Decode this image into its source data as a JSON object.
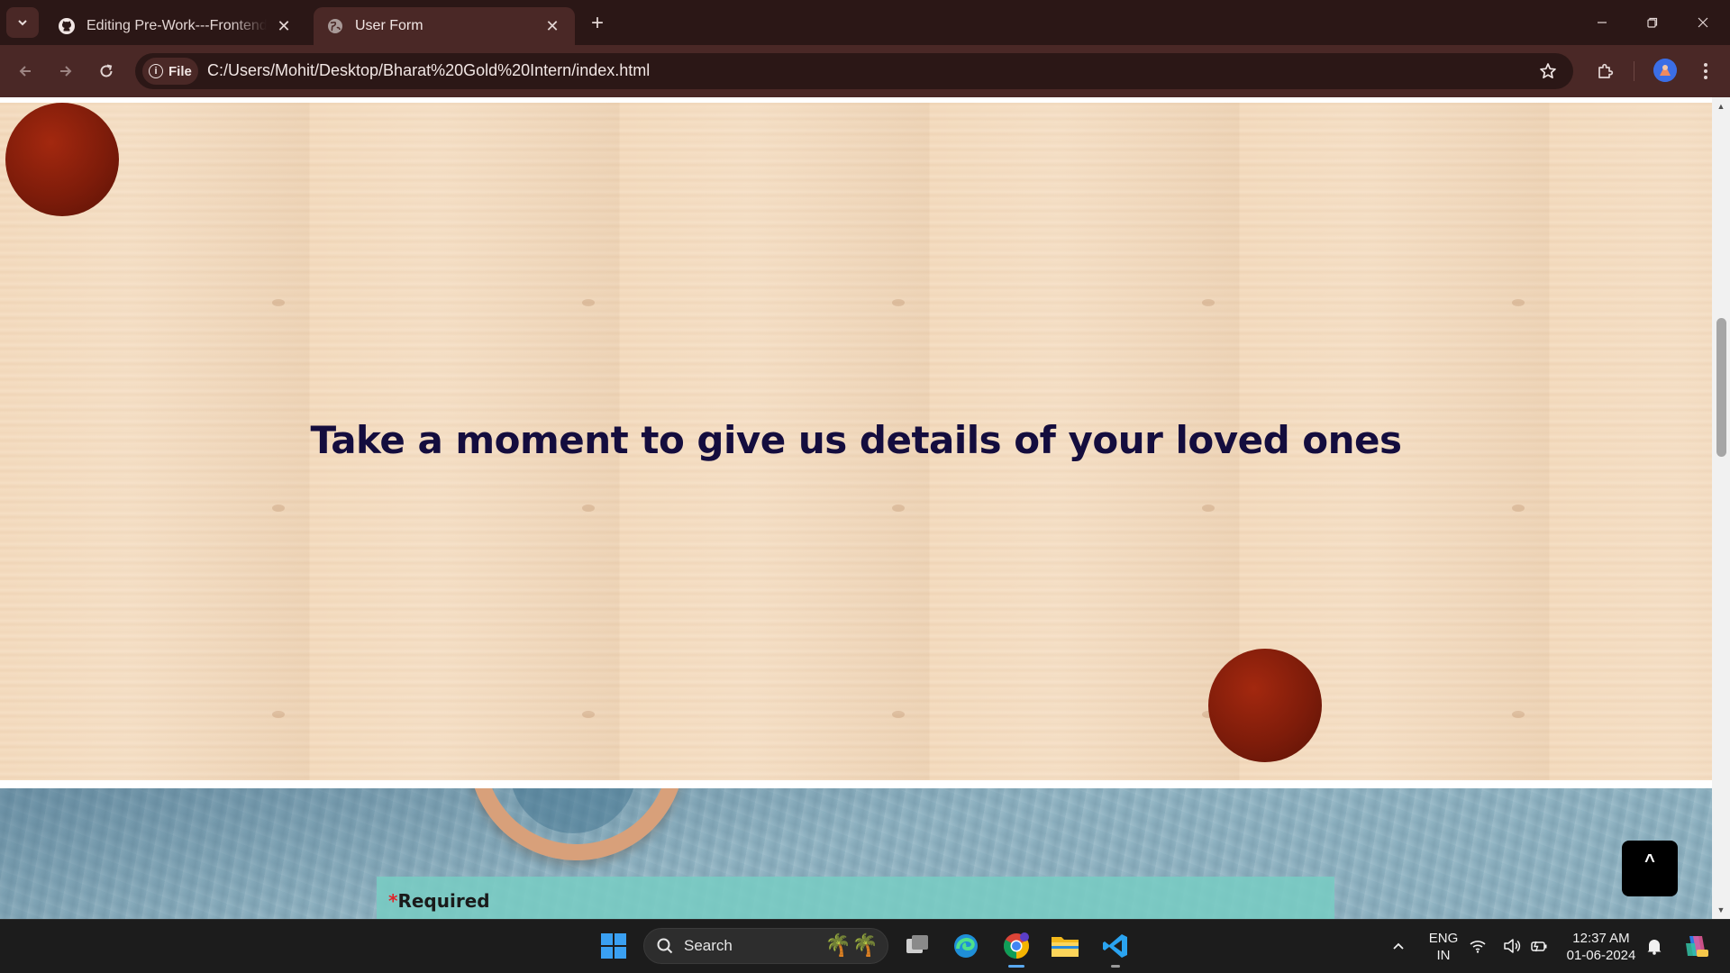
{
  "browser": {
    "tabs": [
      {
        "title": "Editing Pre-Work---Frontend-D",
        "favicon": "github-icon",
        "active": false
      },
      {
        "title": "User Form",
        "favicon": "globe-icon",
        "active": true
      }
    ],
    "site_chip_label": "File",
    "url": "C:/Users/Mohit/Desktop/Bharat%20Gold%20Intern/index.html"
  },
  "page": {
    "headline": "Take a moment to give us details of your loved ones",
    "required_asterisk": "*",
    "required_label": "Required",
    "back_to_top_label": "^"
  },
  "taskbar": {
    "search_placeholder": "Search",
    "apps": [
      "start-icon",
      "search-icon",
      "task-view-icon",
      "edge-icon",
      "chrome-icon",
      "file-explorer-icon",
      "vscode-icon"
    ]
  },
  "tray": {
    "language_line1": "ENG",
    "language_line2": "IN",
    "time": "12:37 AM",
    "date": "01-06-2024"
  },
  "colors": {
    "chrome_dark": "#2b1716",
    "chrome_toolbar": "#4a2826",
    "headline": "#140d3e",
    "ball": "#8a200c",
    "required_asterisk": "#e0242a"
  }
}
